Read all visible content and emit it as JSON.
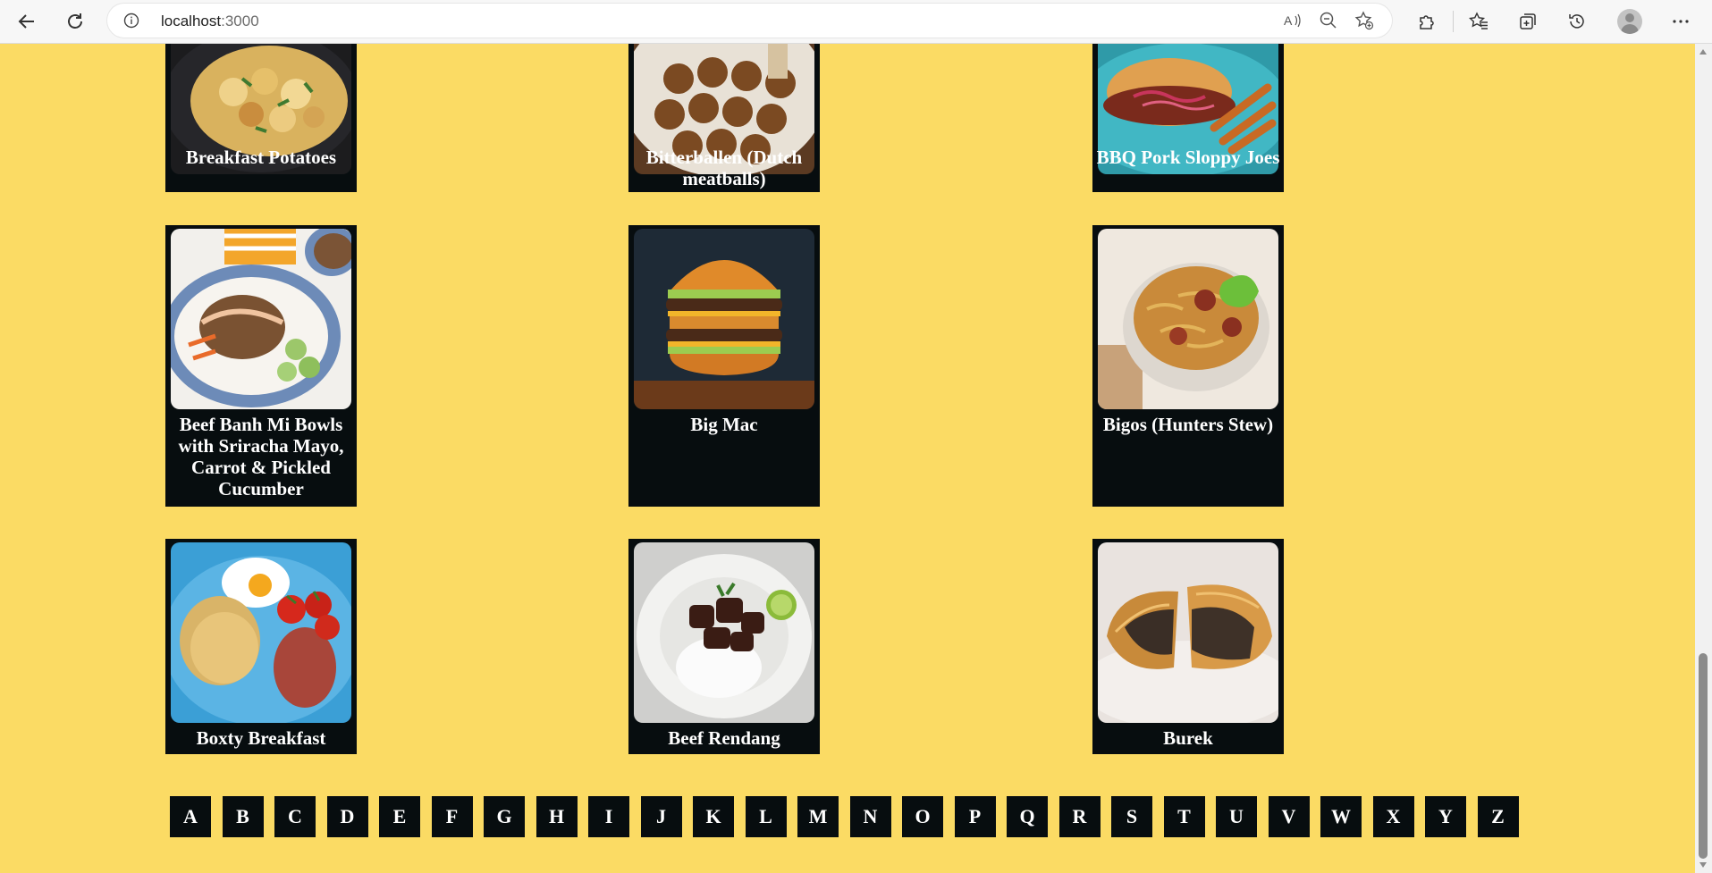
{
  "browser": {
    "url_host": "localhost",
    "url_port": ":3000"
  },
  "recipes": [
    {
      "name": "Breakfast Potatoes",
      "image": "breakfast-potatoes"
    },
    {
      "name": "Bitterballen (Dutch meatballs)",
      "image": "bitterballen"
    },
    {
      "name": "BBQ Pork Sloppy Joes",
      "image": "bbq-pork-sloppy-joes"
    },
    {
      "name": "Beef Banh Mi Bowls with Sriracha Mayo, Carrot & Pickled Cucumber",
      "image": "beef-banh-mi-bowl"
    },
    {
      "name": "Big Mac",
      "image": "big-mac"
    },
    {
      "name": "Bigos (Hunters Stew)",
      "image": "bigos"
    },
    {
      "name": "Boxty Breakfast",
      "image": "boxty-breakfast"
    },
    {
      "name": "Beef Rendang",
      "image": "beef-rendang"
    },
    {
      "name": "Burek",
      "image": "burek"
    }
  ],
  "alphabet": [
    "A",
    "B",
    "C",
    "D",
    "E",
    "F",
    "G",
    "H",
    "I",
    "J",
    "K",
    "L",
    "M",
    "N",
    "O",
    "P",
    "Q",
    "R",
    "S",
    "T",
    "U",
    "V",
    "W",
    "X",
    "Y",
    "Z"
  ],
  "colors": {
    "page_background": "#fbdb64",
    "card_background": "#070d0f",
    "card_text": "#ffffff"
  }
}
